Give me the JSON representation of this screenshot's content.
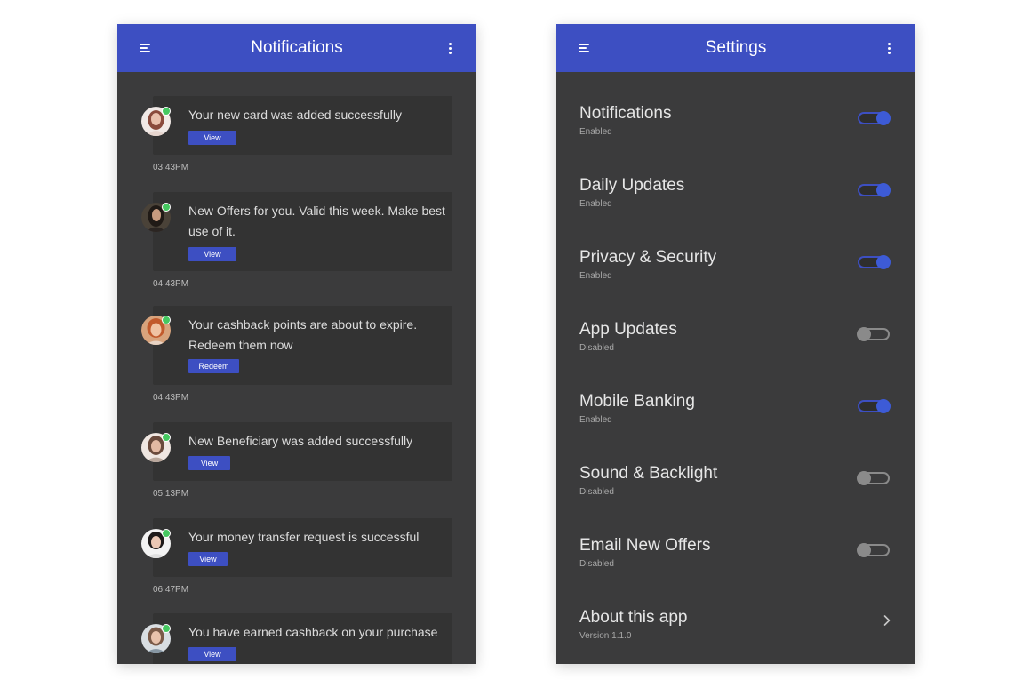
{
  "notifications_screen": {
    "title": "Notifications",
    "items": [
      {
        "message": "Your new card was added successfully",
        "action": "View",
        "time": "03:43PM"
      },
      {
        "message": "New Offers for you. Valid this week. Make best use of it.",
        "action": "View",
        "time": "04:43PM"
      },
      {
        "message": "Your cashback points are about to expire. Redeem them now",
        "action": "Redeem",
        "time": "04:43PM"
      },
      {
        "message": "New Beneficiary was added successfully",
        "action": "View",
        "time": "05:13PM"
      },
      {
        "message": "Your money transfer request is successful",
        "action": "View",
        "time": "06:47PM"
      },
      {
        "message": "You have earned cashback on your purchase",
        "action": "View"
      }
    ]
  },
  "settings_screen": {
    "title": "Settings",
    "items": [
      {
        "label": "Notifications",
        "status": "Enabled",
        "enabled": true
      },
      {
        "label": "Daily Updates",
        "status": "Enabled",
        "enabled": true
      },
      {
        "label": "Privacy & Security",
        "status": "Enabled",
        "enabled": true
      },
      {
        "label": "App Updates",
        "status": "Disabled",
        "enabled": false
      },
      {
        "label": "Mobile Banking",
        "status": "Enabled",
        "enabled": true
      },
      {
        "label": "Sound & Backlight",
        "status": "Disabled",
        "enabled": false
      },
      {
        "label": "Email New Offers",
        "status": "Disabled",
        "enabled": false
      }
    ],
    "about": {
      "label": "About this app",
      "version": "Version 1.1.0"
    }
  },
  "colors": {
    "primary": "#3d4fc2",
    "background": "#3b3b3c",
    "card": "#333333",
    "online_dot": "#45c860"
  }
}
